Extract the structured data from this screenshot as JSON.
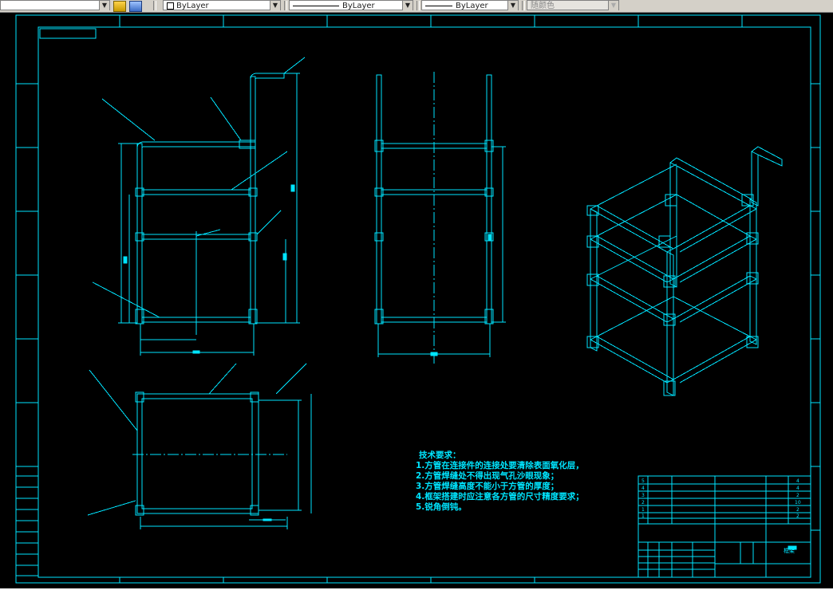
{
  "toolbar": {
    "color_box_label": "ByLayer",
    "linetype_label": "ByLayer",
    "lineweight_label": "ByLayer",
    "plotstyle_label": "随颜色"
  },
  "tech_requirements": {
    "title": "技术要求：",
    "items": [
      "1.方管在连接件的连接处要清除表面氧化层，",
      "2.方管焊缝处不得出现气孔沙眼现象；",
      "3.方管焊缝高度不能小于方管的厚度；",
      "4.框架搭建时应注意各方管的尺寸精度要求；",
      "5.锐角倒钝。"
    ]
  },
  "bom": {
    "rows": [
      {
        "no": "5",
        "qty": "4"
      },
      {
        "no": "4",
        "qty": "4"
      },
      {
        "no": "3",
        "qty": "2"
      },
      {
        "no": "2",
        "qty": "10"
      },
      {
        "no": "1",
        "qty": "2"
      },
      {
        "no": "1",
        "qty": "2"
      }
    ]
  },
  "title_block": {
    "part_name": "框架"
  },
  "colors": {
    "background": "#000000",
    "drawing": "#00e5ff",
    "toolbar": "#d4d0c8"
  }
}
